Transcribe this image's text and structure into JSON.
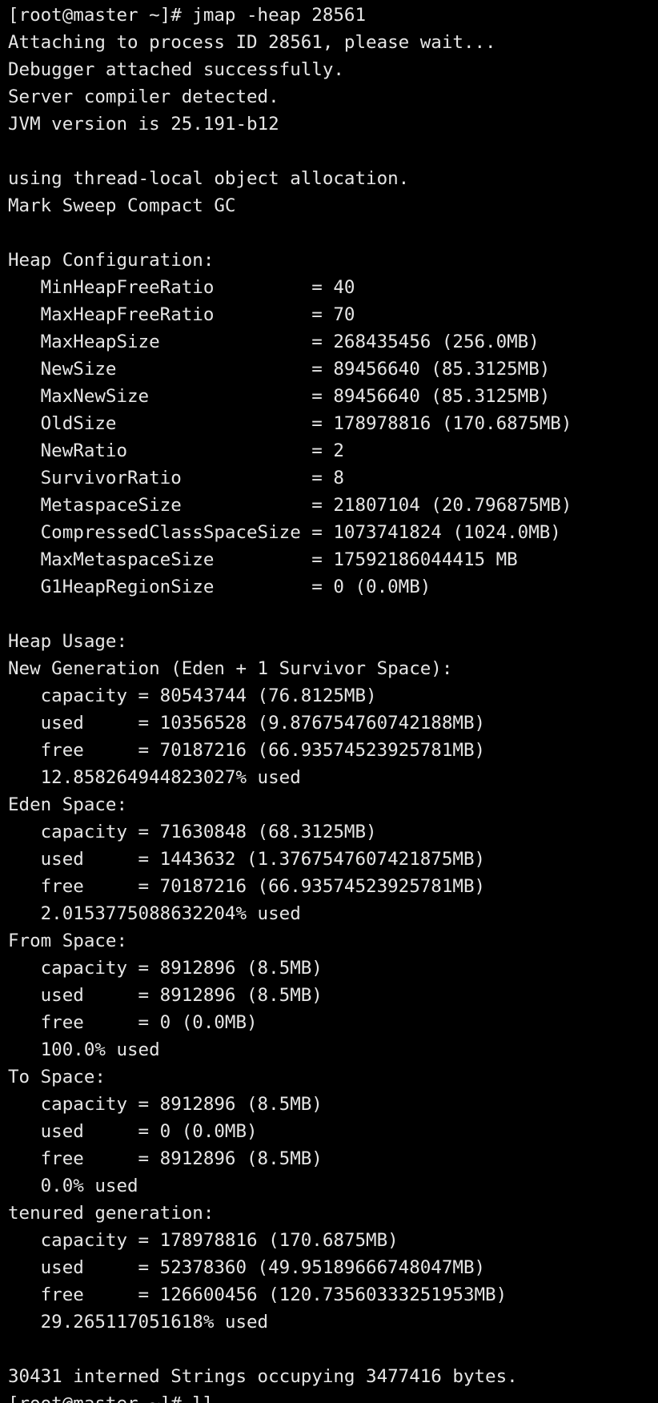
{
  "terminal": {
    "background": "#000000",
    "foreground": "#e6e6e6",
    "lines": [
      "[root@master ~]# jmap -heap 28561",
      "Attaching to process ID 28561, please wait...",
      "Debugger attached successfully.",
      "Server compiler detected.",
      "JVM version is 25.191-b12",
      "",
      "using thread-local object allocation.",
      "Mark Sweep Compact GC",
      "",
      "Heap Configuration:",
      "   MinHeapFreeRatio         = 40",
      "   MaxHeapFreeRatio         = 70",
      "   MaxHeapSize              = 268435456 (256.0MB)",
      "   NewSize                  = 89456640 (85.3125MB)",
      "   MaxNewSize               = 89456640 (85.3125MB)",
      "   OldSize                  = 178978816 (170.6875MB)",
      "   NewRatio                 = 2",
      "   SurvivorRatio            = 8",
      "   MetaspaceSize            = 21807104 (20.796875MB)",
      "   CompressedClassSpaceSize = 1073741824 (1024.0MB)",
      "   MaxMetaspaceSize         = 17592186044415 MB",
      "   G1HeapRegionSize         = 0 (0.0MB)",
      "",
      "Heap Usage:",
      "New Generation (Eden + 1 Survivor Space):",
      "   capacity = 80543744 (76.8125MB)",
      "   used     = 10356528 (9.876754760742188MB)",
      "   free     = 70187216 (66.93574523925781MB)",
      "   12.858264944823027% used",
      "Eden Space:",
      "   capacity = 71630848 (68.3125MB)",
      "   used     = 1443632 (1.3767547607421875MB)",
      "   free     = 70187216 (66.93574523925781MB)",
      "   2.0153775088632204% used",
      "From Space:",
      "   capacity = 8912896 (8.5MB)",
      "   used     = 8912896 (8.5MB)",
      "   free     = 0 (0.0MB)",
      "   100.0% used",
      "To Space:",
      "   capacity = 8912896 (8.5MB)",
      "   used     = 0 (0.0MB)",
      "   free     = 8912896 (8.5MB)",
      "   0.0% used",
      "tenured generation:",
      "   capacity = 178978816 (170.6875MB)",
      "   used     = 52378360 (49.95189666748047MB)",
      "   free     = 126600456 (120.73560333251953MB)",
      "   29.265117051618% used",
      "",
      "30431 interned Strings occupying 3477416 bytes.",
      "[root@master ~]# ll"
    ]
  }
}
